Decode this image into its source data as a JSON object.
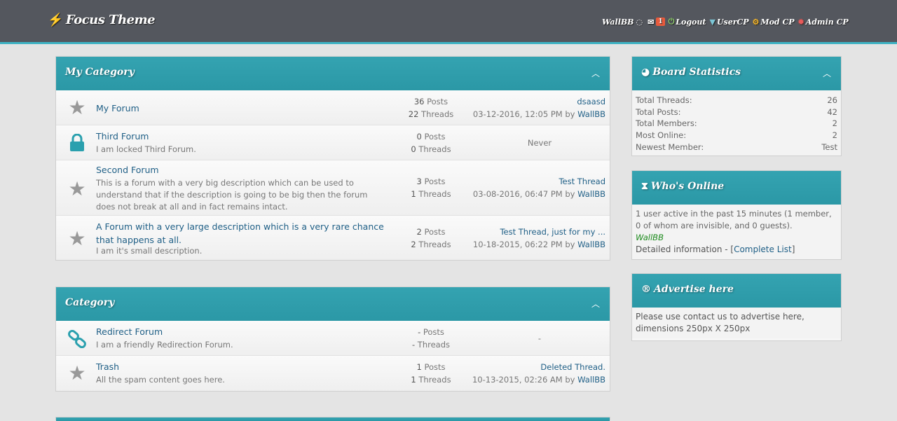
{
  "header": {
    "logo": "Focus Theme",
    "nav": [
      {
        "label": "WallBB",
        "icon": "circle-spinner-icon"
      },
      {
        "label": "",
        "icon": "envelope-icon",
        "badge": "1"
      },
      {
        "label": "Logout",
        "icon": "power-icon"
      },
      {
        "label": "UserCP",
        "icon": "filter-icon"
      },
      {
        "label": "Mod CP",
        "icon": "cogs-icon"
      },
      {
        "label": "Admin CP",
        "icon": "gear-icon"
      }
    ]
  },
  "categories": [
    {
      "title": "My Category",
      "forums": [
        {
          "name": "My Forum",
          "desc": "",
          "posts": "36",
          "threads": "22",
          "posts_label": "Posts",
          "threads_label": "Threads",
          "last_title": "dsaasd",
          "last_date": "03-12-2016, 12:05 PM",
          "by": "by",
          "last_user": "WallBB",
          "icon": "star-icon"
        },
        {
          "name": "Third Forum",
          "desc": "I am locked Third Forum.",
          "posts": "0",
          "threads": "0",
          "posts_label": "Posts",
          "threads_label": "Threads",
          "last_text": "Never",
          "icon": "lock-icon"
        },
        {
          "name": "Second Forum",
          "desc": "This is a forum with a very big description which can be used to understand that if the description is going to be big then the forum does not break at all and in fact remains intact.",
          "posts": "3",
          "threads": "1",
          "posts_label": "Posts",
          "threads_label": "Threads",
          "last_title": "Test Thread",
          "last_date": "03-08-2016, 06:47 PM",
          "by": "by",
          "last_user": "WallBB",
          "icon": "star-icon"
        },
        {
          "name": "A Forum with a very large description which is a very rare chance that happens at all.",
          "desc": "I am it's small description.",
          "posts": "2",
          "threads": "2",
          "posts_label": "Posts",
          "threads_label": "Threads",
          "last_title": "Test Thread, just for my ...",
          "last_date": "10-18-2015, 06:22 PM",
          "by": "by",
          "last_user": "WallBB",
          "icon": "star-icon"
        }
      ]
    },
    {
      "title": "Category",
      "forums": [
        {
          "name": "Redirect Forum",
          "desc": "I am a friendly Redirection Forum.",
          "posts": "-",
          "threads": "-",
          "posts_label": "Posts",
          "threads_label": "Threads",
          "last_text": "-",
          "icon": "link-icon"
        },
        {
          "name": "Trash",
          "desc": "All the spam content goes here.",
          "posts": "1",
          "threads": "1",
          "posts_label": "Posts",
          "threads_label": "Threads",
          "last_title": "Deleted Thread.",
          "last_date": "10-13-2015, 02:26 AM",
          "by": "by",
          "last_user": "WallBB",
          "icon": "star-icon"
        }
      ]
    }
  ],
  "sidebar": {
    "stats": {
      "title": "Board Statistics",
      "rows": [
        {
          "label": "Total Threads:",
          "value": "26"
        },
        {
          "label": "Total Posts:",
          "value": "42"
        },
        {
          "label": "Total Members:",
          "value": "2"
        },
        {
          "label": "Most Online:",
          "value": "2"
        },
        {
          "label": "Newest Member:",
          "value": "Test"
        }
      ]
    },
    "online": {
      "title": "Who's Online",
      "text": "1 user active in the past 15 minutes (1 member, 0 of whom are invisible, and 0 guests).",
      "user": "WallBB",
      "detail_prefix": "Detailed information - [",
      "detail_link": "Complete List",
      "detail_suffix": "]"
    },
    "advertise": {
      "title": "Advertise here",
      "text": "Please use contact us to advertise here, dimensions 250px X 250px"
    }
  }
}
